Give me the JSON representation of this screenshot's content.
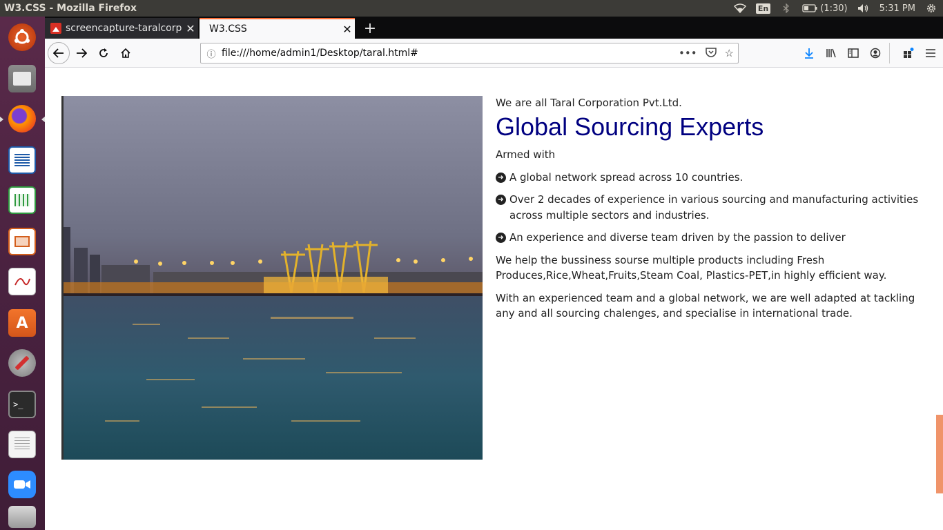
{
  "os": {
    "window_title": "W3.CSS - Mozilla Firefox",
    "lang": "En",
    "battery": "(1:30)",
    "time": "5:31 PM"
  },
  "launcher": {
    "items": [
      "ubuntu-dash",
      "files",
      "firefox",
      "writer",
      "calc",
      "impress",
      "document-viewer",
      "software-center",
      "system-settings",
      "terminal",
      "text-editor",
      "zoom",
      "disk"
    ]
  },
  "browser": {
    "tabs": [
      {
        "label": "screencapture-taralcorp",
        "active": false
      },
      {
        "label": "W3.CSS",
        "active": true
      }
    ],
    "url": "file:///home/admin1/Desktop/taral.html#",
    "url_actions": "•••"
  },
  "page": {
    "intro": "We are all Taral Corporation Pvt.Ltd.",
    "headline": "Global Sourcing Experts",
    "armed_with": "Armed with",
    "bullets": [
      "A global network spread across 10 countries.",
      "Over 2 decades of experience in various sourcing and manufacturing activities across multiple sectors and industries.",
      "An experience and diverse team driven by the passion to deliver"
    ],
    "para1": "We help the bussiness sourse multiple products including Fresh Produces,Rice,Wheat,Fruits,Steam Coal, Plastics-PET,in highly efficient way.",
    "para2": "With an experienced team and a global network, we are well adapted at tackling any and all sourcing chalenges, and specialise in international trade."
  },
  "colors": {
    "headline": "#000080",
    "scroll_thumb": "#f0946a",
    "active_tab_accent": "#ff7139"
  }
}
